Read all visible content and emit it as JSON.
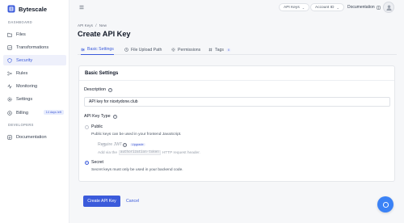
{
  "brand": {
    "name": "Bytescale"
  },
  "sidebar": {
    "section_dashboard": "DASHBOARD",
    "section_developers": "DEVELOPERS",
    "items": [
      {
        "label": "Files",
        "icon": "folder-icon"
      },
      {
        "label": "Transformations",
        "icon": "transformations-icon"
      },
      {
        "label": "Security",
        "icon": "shield-icon",
        "active": true
      },
      {
        "label": "Rules",
        "icon": "rules-icon"
      },
      {
        "label": "Monitoring",
        "icon": "monitoring-icon"
      },
      {
        "label": "Settings",
        "icon": "gear-icon"
      },
      {
        "label": "Billing",
        "icon": "billing-icon",
        "badge": "14 days left"
      }
    ],
    "dev_items": [
      {
        "label": "Documentation",
        "icon": "book-icon"
      }
    ]
  },
  "header": {
    "api_keys_pill": "API Keys",
    "account_pill": "Account ID",
    "documentation": "Documentation"
  },
  "breadcrumb": {
    "parent": "API Keys",
    "sep": "/",
    "current": "New"
  },
  "page": {
    "title": "Create API Key"
  },
  "tabs": [
    {
      "label": "Basic Settings",
      "active": true
    },
    {
      "label": "File Upload Path"
    },
    {
      "label": "Permissions"
    },
    {
      "label": "Tags",
      "count": "0"
    }
  ],
  "form": {
    "card_title": "Basic Settings",
    "description_label": "Description",
    "description_value": "API key for nicetydone.club",
    "key_type_label": "API Key Type",
    "public_label": "Public",
    "public_desc": "Public keys can be used in your frontend JavaScript.",
    "require_jwt_label": "Require JWT",
    "upgrade_label": "Upgrade",
    "jwt_desc_prefix": "Add via the",
    "jwt_desc_code": "authorization-token",
    "jwt_desc_suffix": "HTTP request header.",
    "secret_label": "Secret",
    "secret_desc": "Secret keys must only be used in your backend code."
  },
  "actions": {
    "create": "Create API Key",
    "cancel": "Cancel"
  },
  "colors": {
    "accent": "#3b5bdb",
    "fab": "#3b82f6"
  }
}
